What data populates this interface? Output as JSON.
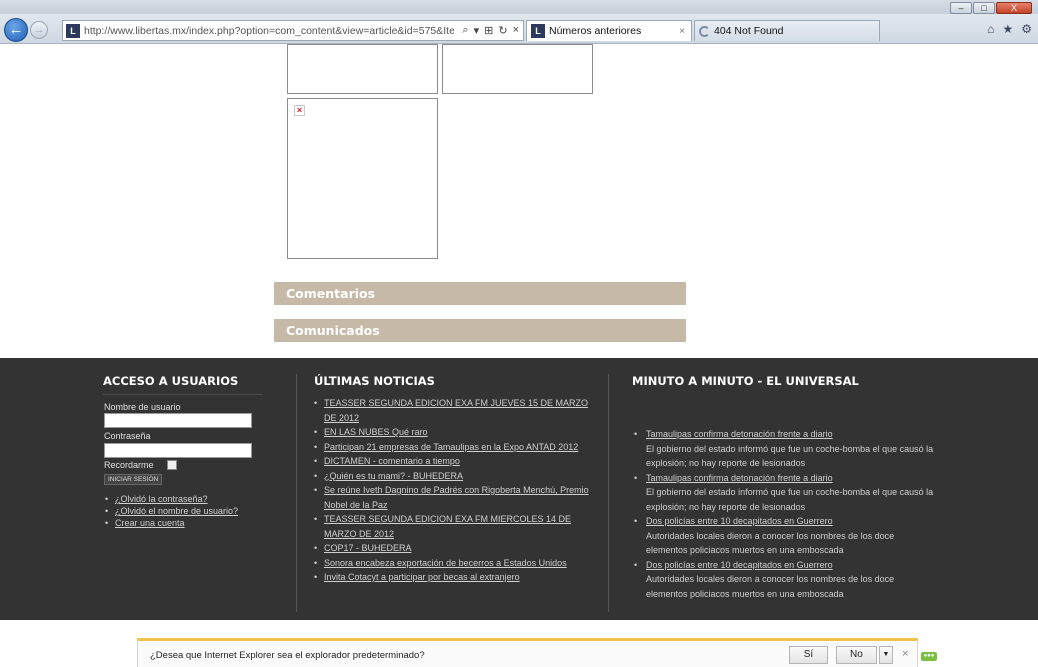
{
  "browser": {
    "url": "http://www.libertas.mx/index.php?option=com_content&view=article&id=575&Item",
    "favicon_letter": "L",
    "tabs": [
      {
        "label": "Números anteriores",
        "close": "×"
      },
      {
        "label": "404 Not Found"
      }
    ],
    "window_controls": {
      "minimize": "–",
      "maximize": "□",
      "close": "X"
    },
    "back_glyph": "←",
    "forward_glyph": "→",
    "addr_tools": {
      "search": "⌕",
      "dropdown": "▾",
      "compat": "⊞",
      "refresh": "↻",
      "stop": "×"
    },
    "right_icons": {
      "home": "⌂",
      "favorites": "★",
      "settings": "⚙"
    }
  },
  "page": {
    "broken_image_glyph": "×",
    "accordions": [
      {
        "label": "Comentarios"
      },
      {
        "label": "Comunicados"
      }
    ]
  },
  "footer": {
    "acceso": {
      "heading": "ACCESO A USUARIOS",
      "username_label": "Nombre de usuario",
      "password_label": "Contraseña",
      "remember_label": "Recordarme",
      "login_button": "INICIAR SESIÓN",
      "links": [
        "¿Olvidó la contraseña?",
        "¿Olvidó el nombre de usuario?",
        "Crear una cuenta"
      ]
    },
    "ultimas": {
      "heading": "ÚLTIMAS NOTICIAS",
      "items": [
        "TEASSER SEGUNDA EDICION EXA FM JUEVES 15 DE MARZO DE 2012",
        "EN LAS NUBES Qué raro",
        "Participan 21 empresas de Tamaulipas en la Expo ANTAD 2012",
        "DICTAMEN - comentario a tiempo",
        "¿Quién es tu mami? - BUHEDERA",
        "Se reúne Iveth Dagnino de Padrés con Rigoberta Menchú, Premio Nobel de la Paz",
        "TEASSER SEGUNDA EDICION EXA FM MIERCOLES 14 DE MARZO DE 2012",
        "COP17 - BUHEDERA",
        "Sonora encabeza exportación de becerros a Estados Unidos",
        "Invita Cotacyt a participar por becas al extranjero"
      ]
    },
    "minuto": {
      "heading": "MINUTO A MINUTO - EL UNIVERSAL",
      "items": [
        {
          "title": "Tamaulipas confirma detonación frente a diario",
          "desc": "El gobierno del estado informó que fue un coche-bomba el que causó la explosión; no hay reporte de lesionados"
        },
        {
          "title": "Tamaulipas confirma detonación frente a diario",
          "desc": "El gobierno del estado informó que fue un coche-bomba el que causó la explosión; no hay reporte de lesionados"
        },
        {
          "title": "Dos policías entre 10 decapitados en Guerrero",
          "desc": "Autoridades locales dieron a conocer los nombres de los doce elementos policiacos muertos en una emboscada"
        },
        {
          "title": "Dos policías entre 10 decapitados en Guerrero",
          "desc": "Autoridades locales dieron a conocer los nombres de los doce elementos policiacos muertos en una emboscada"
        }
      ]
    }
  },
  "notification": {
    "text": "¿Desea que Internet Explorer sea el explorador predeterminado?",
    "yes": "Sí",
    "no": "No",
    "dropdown_glyph": "▼",
    "close_glyph": "×",
    "badge": "●●●"
  }
}
